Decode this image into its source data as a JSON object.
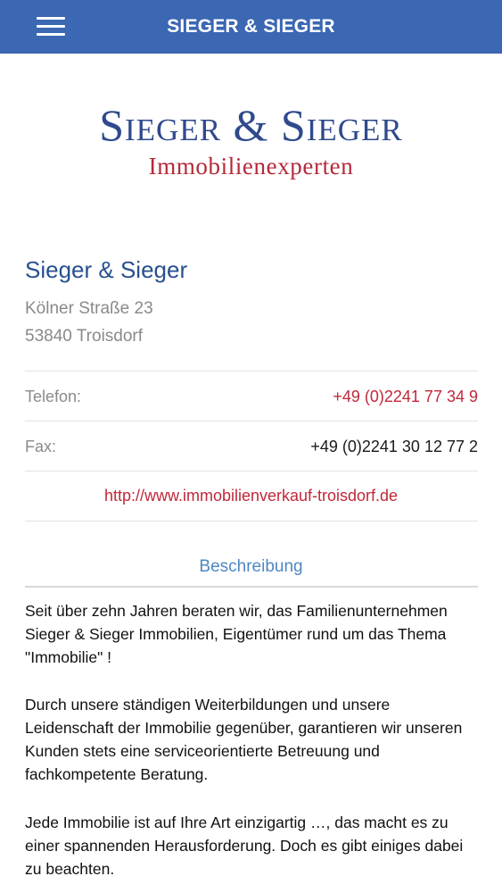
{
  "header": {
    "title": "SIEGER & SIEGER",
    "menu_icon": "hamburger-menu-icon"
  },
  "logo": {
    "main": "Sieger & Sieger",
    "sub": "Immobilienexperten"
  },
  "contact": {
    "name": "Sieger & Sieger",
    "street": "Kölner Straße 23",
    "city": "53840 Troisdorf",
    "phone_label": "Telefon:",
    "phone_value": "+49 (0)2241 77 34 9",
    "fax_label": "Fax:",
    "fax_value": "+49 (0)2241 30 12 77 2",
    "website": "http://www.immobilienverkauf-troisdorf.de"
  },
  "description": {
    "title": "Beschreibung",
    "paragraphs": [
      "Seit über zehn Jahren beraten wir, das Familienunternehmen Sieger & Sieger Immobilien, Eigentümer rund um das Thema \"Immobilie\" !",
      "Durch unsere ständigen Weiterbildungen und unsere Leidenschaft der Immobilie gegenüber, garantieren wir unseren Kunden stets eine serviceorientierte Betreuung und fachkompetente Beratung.",
      "Jede Immobilie ist auf Ihre Art einzigartig …, das macht es zu einer spannenden Herausforderung. Doch es gibt einiges dabei zu beachten."
    ]
  },
  "colors": {
    "header_bg": "#3b67b3",
    "accent_red": "#c0283b",
    "brand_blue": "#27508f",
    "section_blue": "#4f87c2"
  }
}
